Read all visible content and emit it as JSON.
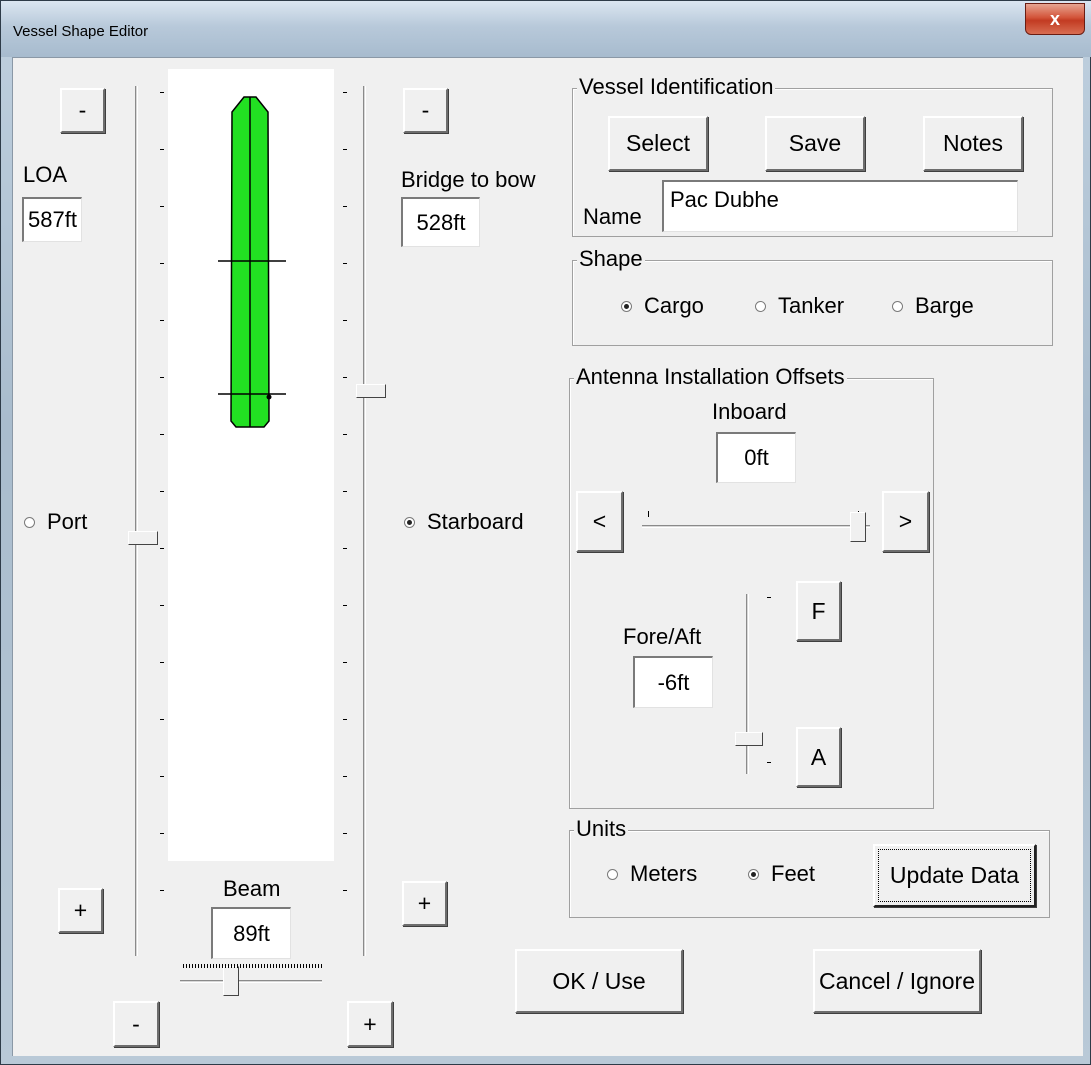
{
  "window": {
    "title": "Vessel Shape Editor",
    "close_label": "x"
  },
  "loa": {
    "label": "LOA",
    "value": "587ft",
    "minus": "-",
    "plus": "+",
    "slider_fraction": 0.52
  },
  "bridge": {
    "label": "Bridge to bow",
    "value": "528ft",
    "minus": "-",
    "plus": "+",
    "slider_fraction": 0.35
  },
  "beam": {
    "label": "Beam",
    "value": "89ft",
    "minus": "-",
    "plus": "+",
    "slider_fraction": 0.36
  },
  "side": {
    "port_label": "Port",
    "starboard_label": "Starboard",
    "selected": "Starboard"
  },
  "vessel_id": {
    "group_title": "Vessel Identification",
    "select_label": "Select",
    "save_label": "Save",
    "notes_label": "Notes",
    "name_label": "Name",
    "name_value": "Pac Dubhe"
  },
  "shape": {
    "group_title": "Shape",
    "options": [
      "Cargo",
      "Tanker",
      "Barge"
    ],
    "selected": "Cargo"
  },
  "antenna": {
    "group_title": "Antenna  Installation Offsets",
    "inboard_label": "Inboard",
    "inboard_value": "0ft",
    "left_label": "<",
    "right_label": ">",
    "inboard_slider_fraction": 1.0,
    "fore_aft_label": "Fore/Aft",
    "fore_aft_value": "-6ft",
    "fore_label": "F",
    "aft_label": "A",
    "fore_aft_slider_fraction": 0.8
  },
  "units": {
    "group_title": "Units",
    "options": [
      "Meters",
      "Feet"
    ],
    "selected": "Feet",
    "update_label": "Update Data"
  },
  "actions": {
    "ok_label": "OK / Use",
    "cancel_label": "Cancel / Ignore"
  },
  "colors": {
    "hull": "#22e022",
    "dialog_bg": "#f0f0f0",
    "close_button": "#c9452b"
  }
}
